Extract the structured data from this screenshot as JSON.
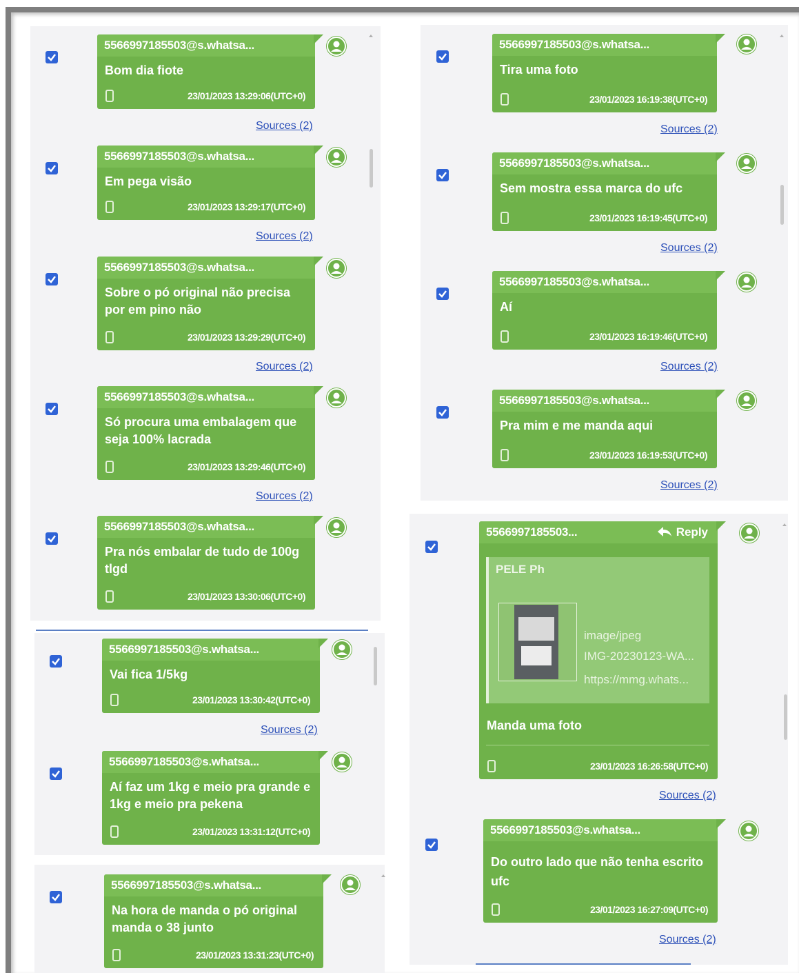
{
  "sources_label": "Sources (2)",
  "reply_label": "Reply",
  "colors": {
    "bubble": "#6fb24a",
    "checkbox": "#2f63d6",
    "link": "#2b4fb8",
    "panel": "#f3f3f5"
  },
  "left_panel_a": {
    "messages": [
      {
        "sender": "5566997185503@s.whatsa...",
        "text": "Bom dia fiote",
        "timestamp": "23/01/2023 13:29:06(UTC+0)"
      },
      {
        "sender": "5566997185503@s.whatsa...",
        "text": "Em pega visão",
        "timestamp": "23/01/2023 13:29:17(UTC+0)"
      },
      {
        "sender": "5566997185503@s.whatsa...",
        "text": "Sobre o pó original não precisa por em pino não",
        "timestamp": "23/01/2023 13:29:29(UTC+0)"
      },
      {
        "sender": "5566997185503@s.whatsa...",
        "text": "Só procura uma embalagem que seja 100% lacrada",
        "timestamp": "23/01/2023 13:29:46(UTC+0)"
      },
      {
        "sender": "5566997185503@s.whatsa...",
        "text": "Pra nós embalar de tudo de 100g tlgd",
        "timestamp": "23/01/2023 13:30:06(UTC+0)"
      }
    ]
  },
  "left_panel_b": {
    "messages": [
      {
        "sender": "5566997185503@s.whatsa...",
        "text": "Vai fica 1/5kg",
        "timestamp": "23/01/2023 13:30:42(UTC+0)"
      },
      {
        "sender": "5566997185503@s.whatsa...",
        "text": "Aí faz um 1kg e meio pra grande e 1kg e meio pra pekena",
        "timestamp": "23/01/2023 13:31:12(UTC+0)"
      }
    ]
  },
  "left_panel_c": {
    "messages": [
      {
        "sender": "5566997185503@s.whatsa...",
        "text": "Na hora de manda o pó original manda o 38 junto",
        "timestamp": "23/01/2023 13:31:23(UTC+0)"
      }
    ]
  },
  "right_panel_a": {
    "messages": [
      {
        "sender": "5566997185503@s.whatsa...",
        "text": "Tira uma foto",
        "timestamp": "23/01/2023 16:19:38(UTC+0)"
      },
      {
        "sender": "5566997185503@s.whatsa...",
        "text": "Sem mostra essa marca do ufc",
        "timestamp": "23/01/2023 16:19:45(UTC+0)"
      },
      {
        "sender": "5566997185503@s.whatsa...",
        "text": "Aí",
        "timestamp": "23/01/2023 16:19:46(UTC+0)"
      },
      {
        "sender": "5566997185503@s.whatsa...",
        "text": "Pra mim e me manda aqui",
        "timestamp": "23/01/2023 16:19:53(UTC+0)"
      }
    ]
  },
  "right_panel_b": {
    "reply_message": {
      "sender": "5566997185503...",
      "quote_title": "PELE Ph",
      "attachment_type": "image/jpeg",
      "attachment_name": "IMG-20230123-WA...",
      "attachment_url": "https://mmg.whats...",
      "text": "Manda uma foto",
      "timestamp": "23/01/2023 16:26:58(UTC+0)"
    },
    "messages": [
      {
        "sender": "5566997185503@s.whatsa...",
        "text": "Do outro lado que não tenha escrito ufc",
        "timestamp": "23/01/2023 16:27:09(UTC+0)"
      }
    ]
  }
}
